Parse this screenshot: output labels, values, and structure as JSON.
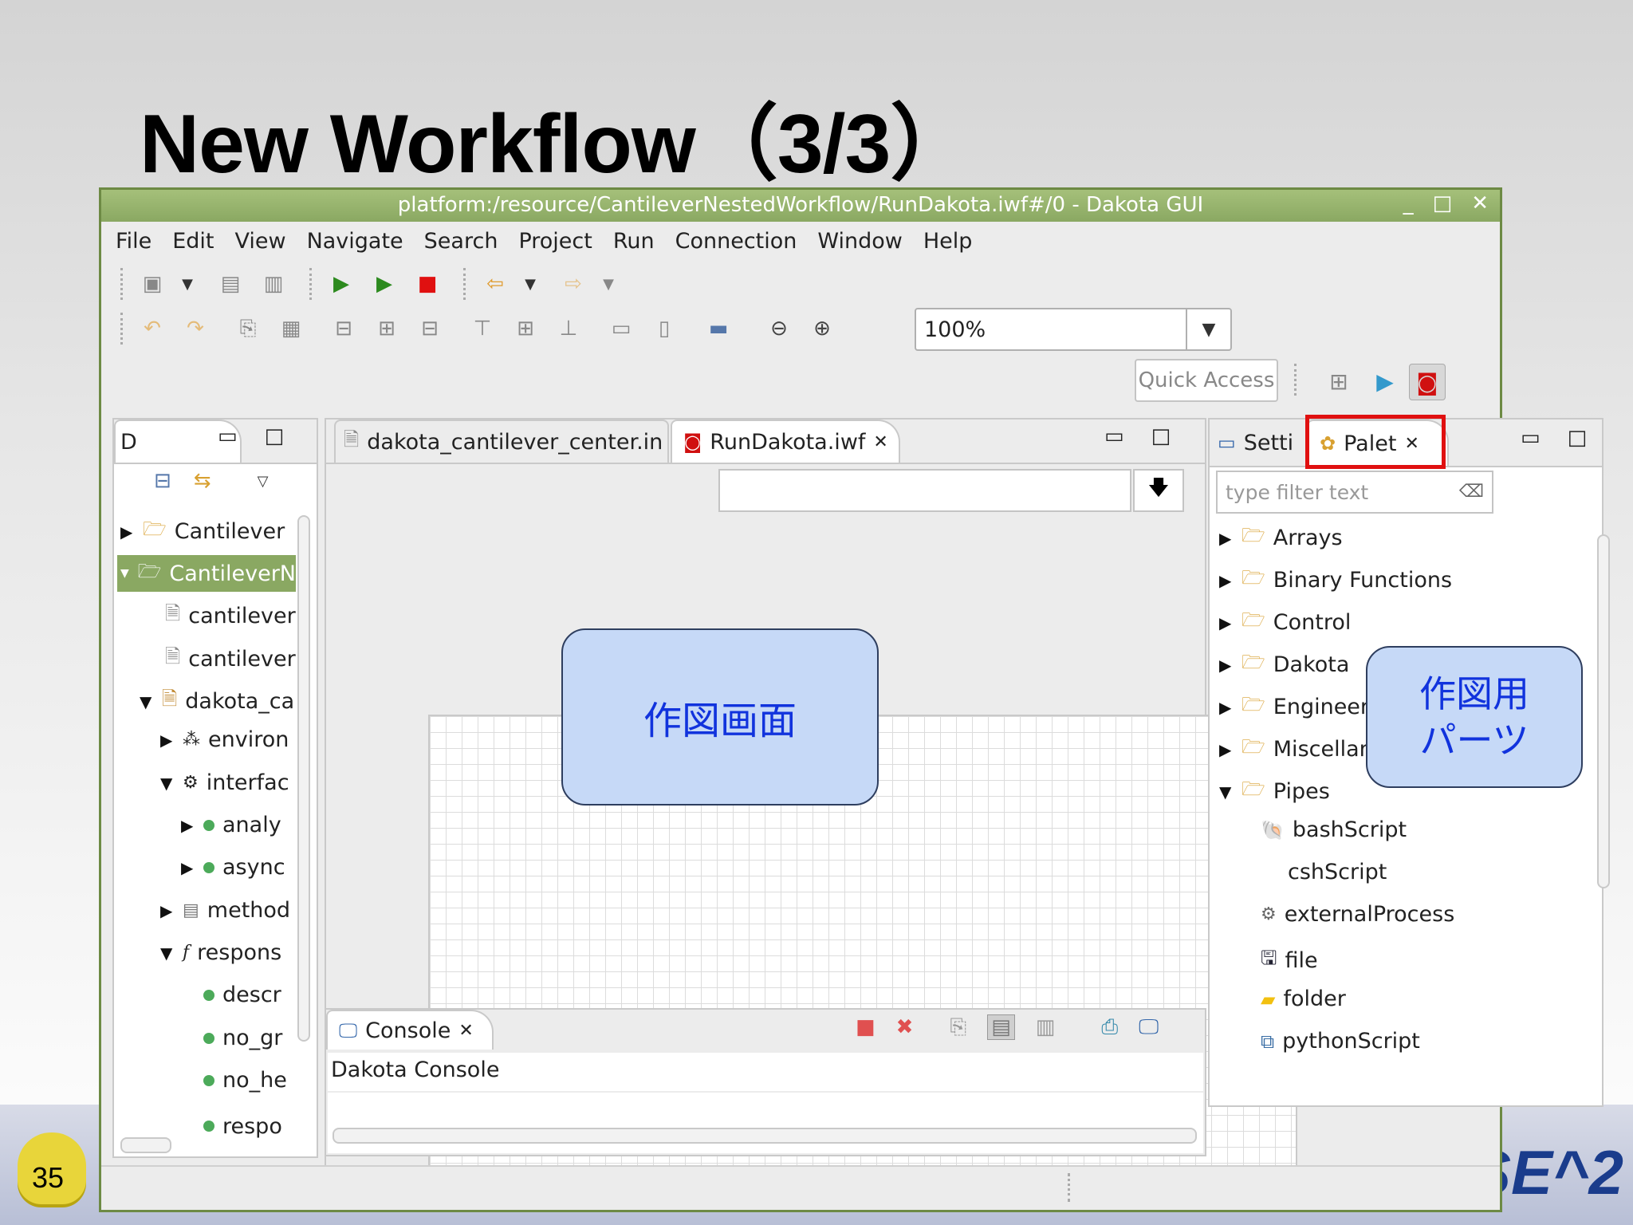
{
  "slide": {
    "title": "New Workflow（3/3）",
    "page_number": "35",
    "footer_logo": "SE^2"
  },
  "window": {
    "title": "platform:/resource/CantileverNestedWorkflow/RunDakota.iwf#/0 - Dakota GUI",
    "controls": [
      "_",
      "□",
      "✕"
    ]
  },
  "menu": [
    {
      "label": "File"
    },
    {
      "label": "Edit"
    },
    {
      "label": "View"
    },
    {
      "label": "Navigate"
    },
    {
      "label": "Search"
    },
    {
      "label": "Project"
    },
    {
      "label": "Run"
    },
    {
      "label": "Connection"
    },
    {
      "label": "Window"
    },
    {
      "label": "Help"
    }
  ],
  "toolbar": {
    "zoom_value": "100%",
    "quick_access_label": "Quick Access"
  },
  "left_panel": {
    "tab_label": "D",
    "tree": [
      {
        "label": "Cantilever",
        "icon": "folder-icon",
        "expander": "collapsed"
      },
      {
        "label": "CantileverN",
        "icon": "folder-icon",
        "expander": "expanded",
        "selected": true
      },
      {
        "label": "cantilever",
        "icon": "file-icon"
      },
      {
        "label": "cantilever",
        "icon": "file-icon"
      },
      {
        "label": "dakota_ca",
        "icon": "file-icon",
        "expander": "expanded"
      },
      {
        "label": "environ",
        "icon": "environment-icon",
        "expander": "collapsed"
      },
      {
        "label": "interfac",
        "icon": "interface-icon",
        "expander": "expanded"
      },
      {
        "label": "analy",
        "icon": "dot-icon",
        "expander": "collapsed"
      },
      {
        "label": "async",
        "icon": "dot-icon",
        "expander": "collapsed"
      },
      {
        "label": "method",
        "icon": "method-icon",
        "expander": "collapsed"
      },
      {
        "label": "respons",
        "icon": "function-icon",
        "expander": "expanded"
      },
      {
        "label": "descr",
        "icon": "dot-icon"
      },
      {
        "label": "no_gr",
        "icon": "dot-icon"
      },
      {
        "label": "no_he",
        "icon": "dot-icon"
      },
      {
        "label": "respo",
        "icon": "dot-icon"
      }
    ]
  },
  "editor": {
    "tabs": [
      {
        "label": "dakota_cantilever_center.in"
      },
      {
        "label": "RunDakota.iwf",
        "active": true
      }
    ],
    "canvas_callout": "作図画面"
  },
  "console": {
    "tab_label": "Console",
    "content": "Dakota Console"
  },
  "right_panel": {
    "tabs": [
      {
        "label": "Setti"
      },
      {
        "label": "Palet",
        "active": true,
        "highlighted": true
      }
    ],
    "filter_placeholder": "type filter text",
    "tree": [
      {
        "label": "Arrays",
        "expander": "collapsed",
        "icon": "folder-icon"
      },
      {
        "label": "Binary Functions",
        "expander": "collapsed",
        "icon": "folder-icon"
      },
      {
        "label": "Control",
        "expander": "collapsed",
        "icon": "folder-icon"
      },
      {
        "label": "Dakota",
        "expander": "collapsed",
        "icon": "folder-icon"
      },
      {
        "label": "Engineeri",
        "expander": "collapsed",
        "icon": "folder-icon"
      },
      {
        "label": "Miscellan",
        "expander": "collapsed",
        "icon": "folder-icon"
      },
      {
        "label": "Pipes",
        "expander": "expanded",
        "icon": "folder-icon"
      },
      {
        "label": "bashScript",
        "icon": "shell-icon"
      },
      {
        "label": "cshScript",
        "icon": ""
      },
      {
        "label": "externalProcess",
        "icon": "gears-icon"
      },
      {
        "label": "file",
        "icon": "floppy-icon"
      },
      {
        "label": "folder",
        "icon": "folder-icon"
      },
      {
        "label": "pythonScript",
        "icon": "python-icon"
      }
    ],
    "callout_line1": "作図用",
    "callout_line2": "パーツ"
  },
  "colors": {
    "titlebar": "#8aa862",
    "selection": "#8aa862",
    "callout_fill": "#c6d9f7",
    "callout_text": "#1133dd",
    "highlight_box": "#e01010"
  }
}
